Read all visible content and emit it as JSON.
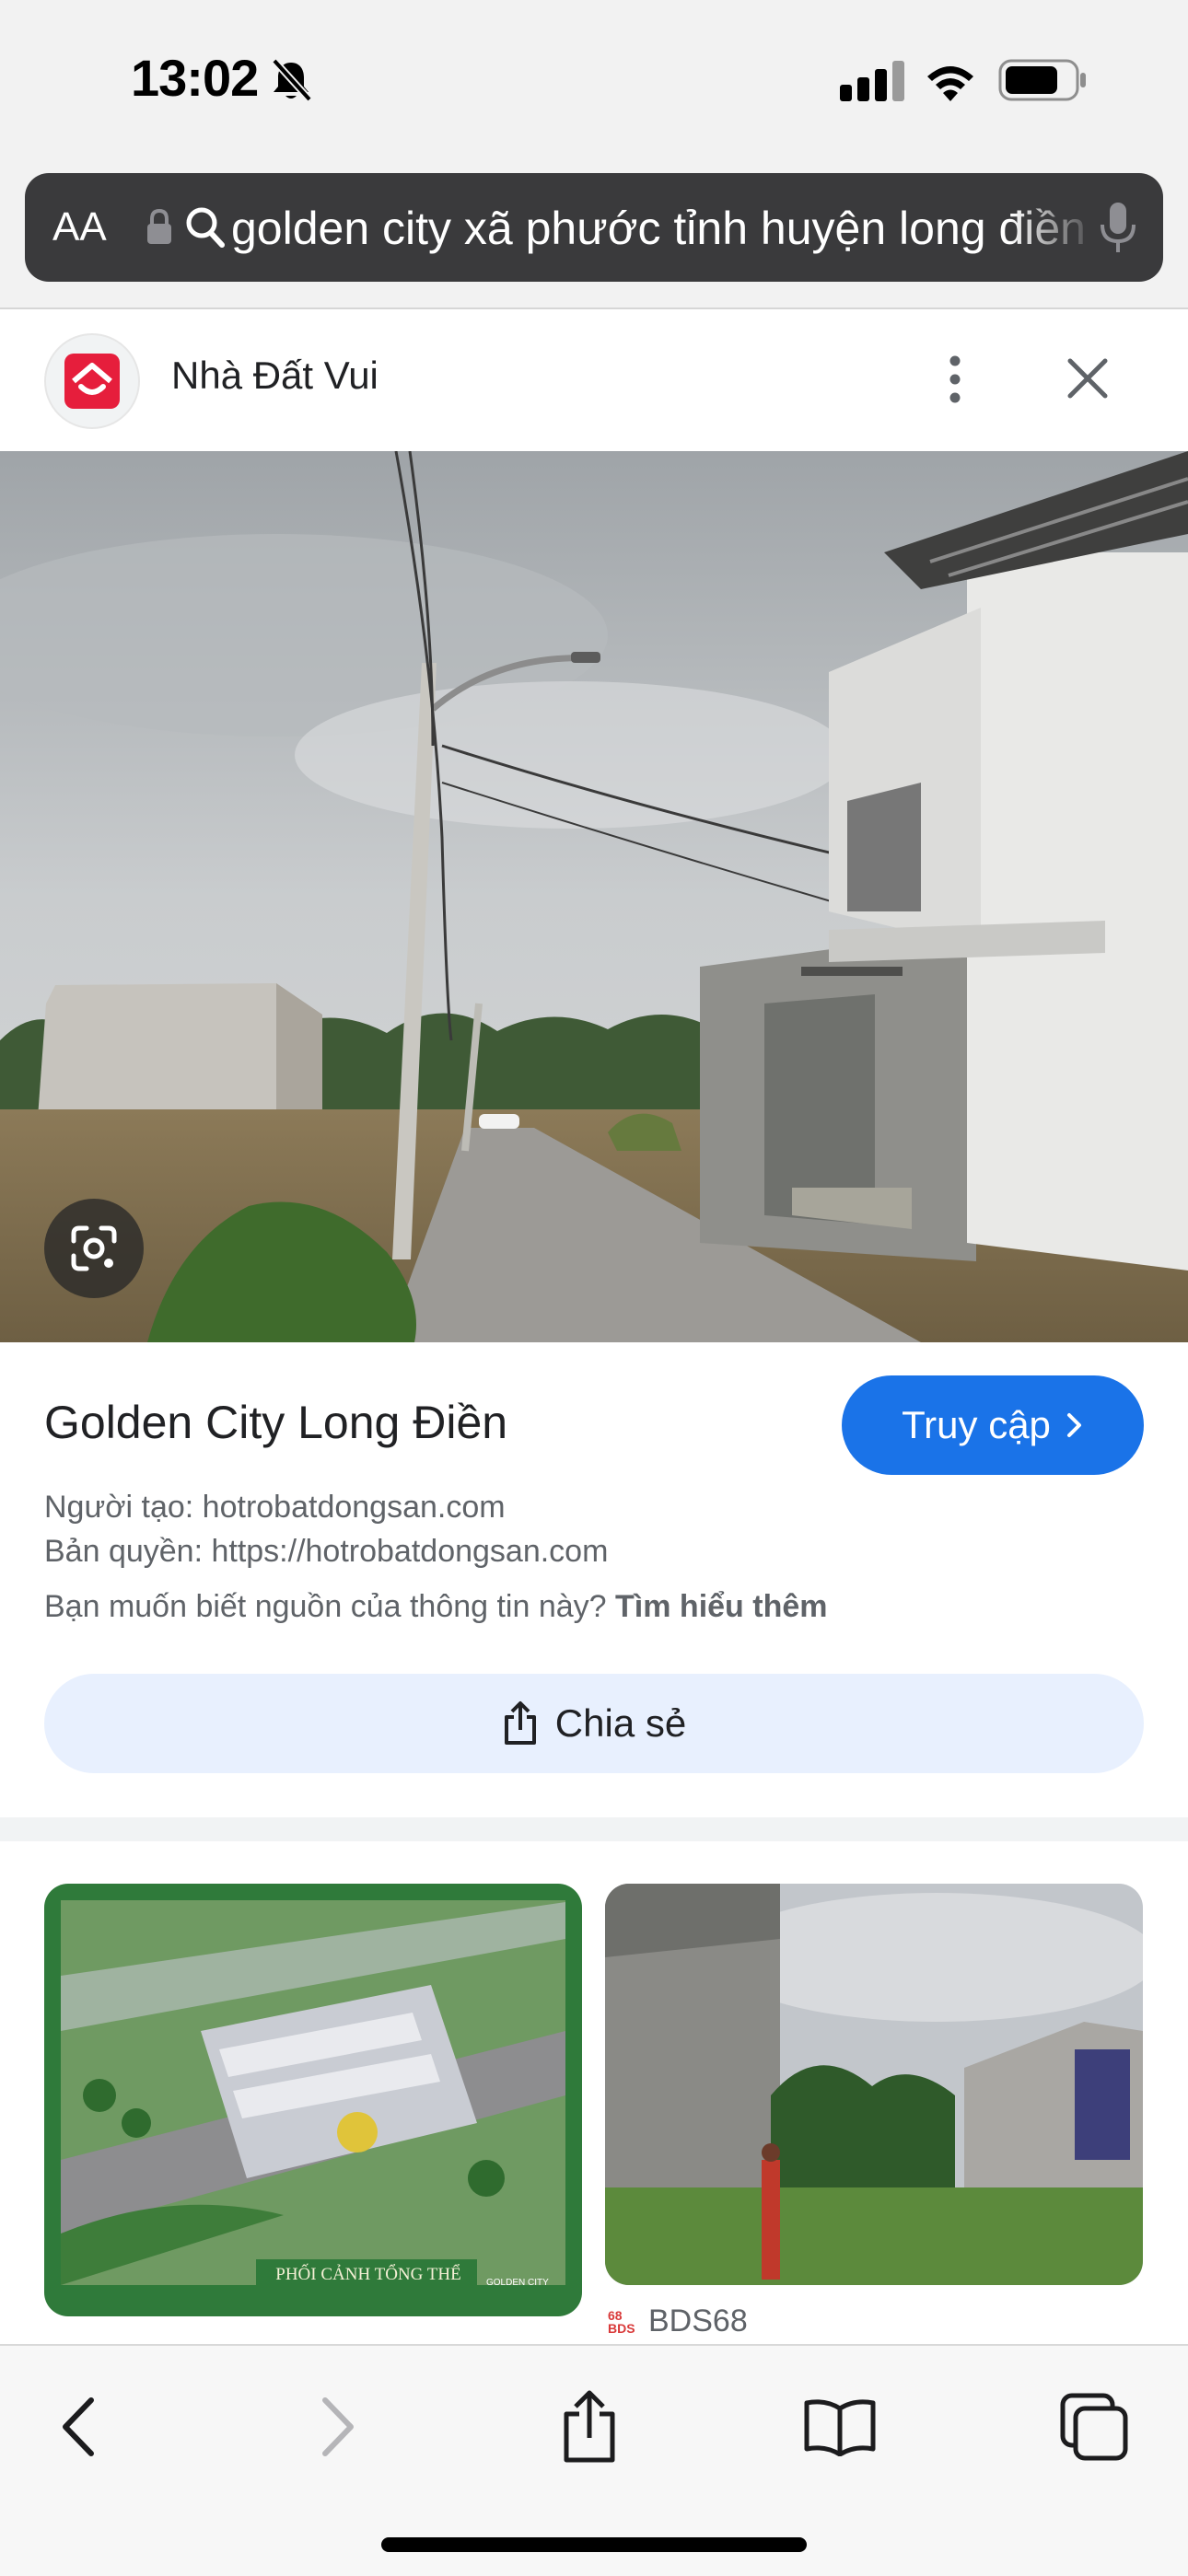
{
  "status_bar": {
    "time": "13:02"
  },
  "address_bar": {
    "text_size_label": "AA",
    "url_text": "golden city xã phước tỉnh huyện long điền"
  },
  "source": {
    "site_name": "Nhà Đất Vui",
    "accent_color": "#e61e3c"
  },
  "result": {
    "title": "Golden City Long Điền",
    "visit_button_label": "Truy cập",
    "creator_line": "Người tạo: hotrobatdongsan.com",
    "copyright_line": "Bản quyền: https://hotrobatdongsan.com",
    "learn_more_prefix": "Bạn muốn biết nguồn của thông tin này?",
    "learn_more_link": "Tìm hiểu thêm",
    "share_button_label": "Chia sẻ"
  },
  "related": {
    "items": [
      {
        "caption": "PHỐI CẢNH TỔNG THỂ",
        "brand": "GOLDEN CITY",
        "source": ""
      },
      {
        "caption": "",
        "brand": "",
        "source": "BDS68",
        "source_logo_text": "68 BDS"
      }
    ]
  },
  "toolbar": {
    "icons": [
      "back-icon",
      "forward-icon",
      "share-icon",
      "bookmarks-icon",
      "tabs-icon"
    ]
  },
  "colors": {
    "link_blue": "#1a73e8",
    "share_bg": "#e8f0fe",
    "address_bar_bg": "#3a3a3c"
  }
}
